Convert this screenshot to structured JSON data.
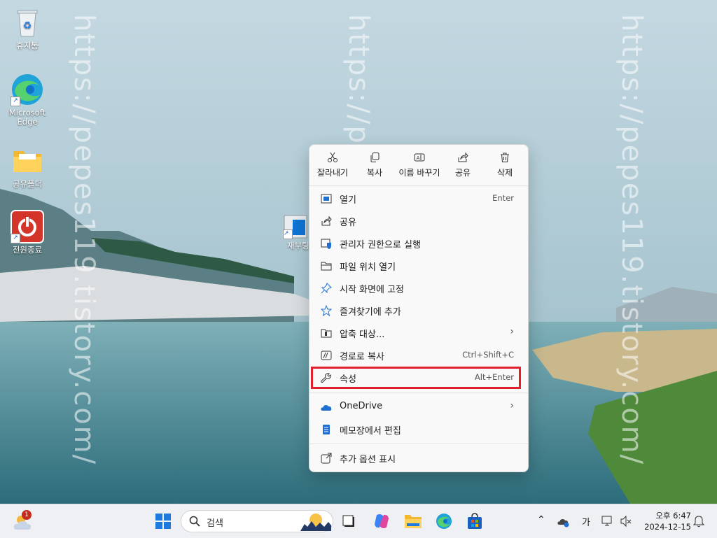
{
  "watermark": "https://pepes119.tistory.com/",
  "desktop": {
    "icons": [
      {
        "label": "휴지통"
      },
      {
        "label": "Microsoft Edge"
      },
      {
        "label": "공유폴더"
      },
      {
        "label": "전원종료"
      },
      {
        "label": "재부팅"
      }
    ]
  },
  "context_menu": {
    "quick_actions": [
      {
        "label": "잘라내기",
        "icon": "scissors-icon"
      },
      {
        "label": "복사",
        "icon": "copy-icon"
      },
      {
        "label": "이름 바꾸기",
        "icon": "rename-icon"
      },
      {
        "label": "공유",
        "icon": "share-icon"
      },
      {
        "label": "삭제",
        "icon": "trash-icon"
      }
    ],
    "items": [
      {
        "label": "열기",
        "shortcut": "Enter",
        "icon": "open-icon"
      },
      {
        "label": "공유",
        "shortcut": "",
        "icon": "share-icon"
      },
      {
        "label": "관리자 권한으로 실행",
        "shortcut": "",
        "icon": "admin-shield-icon"
      },
      {
        "label": "파일 위치 열기",
        "shortcut": "",
        "icon": "folder-icon"
      },
      {
        "label": "시작 화면에 고정",
        "shortcut": "",
        "icon": "pin-icon"
      },
      {
        "label": "즐겨찾기에 추가",
        "shortcut": "",
        "icon": "star-icon"
      },
      {
        "label": "압축 대상...",
        "shortcut": "",
        "icon": "zip-icon"
      },
      {
        "label": "경로로 복사",
        "shortcut": "Ctrl+Shift+C",
        "icon": "path-icon"
      },
      {
        "label": "속성",
        "shortcut": "Alt+Enter",
        "icon": "wrench-icon"
      },
      {
        "label": "OneDrive",
        "shortcut": "",
        "icon": "cloud-icon"
      },
      {
        "label": "메모장에서 편집",
        "shortcut": "",
        "icon": "notepad-icon"
      },
      {
        "label": "추가 옵션 표시",
        "shortcut": "",
        "icon": "more-options-icon"
      }
    ]
  },
  "taskbar": {
    "weather_badge": "1",
    "search_label": "검색",
    "ime": "가",
    "time": "오후 6:47",
    "date": "2024-12-15"
  },
  "colors": {
    "highlight": "#e0202a",
    "accent": "#0067c0"
  }
}
